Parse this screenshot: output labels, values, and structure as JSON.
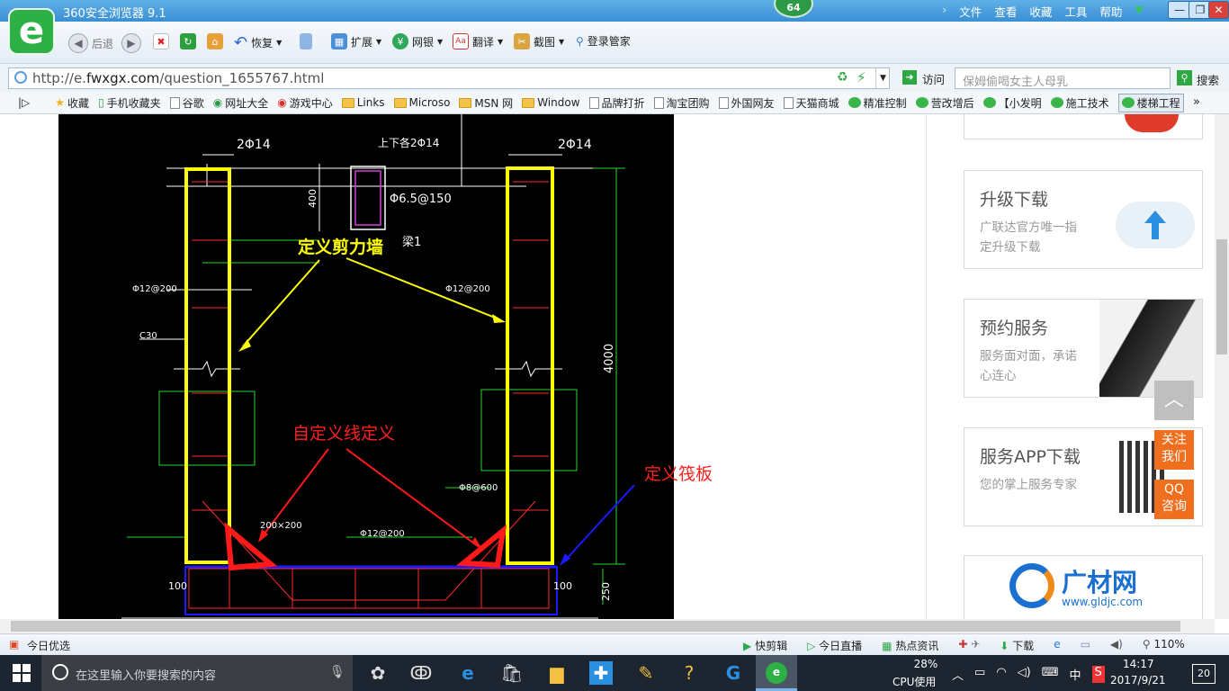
{
  "window": {
    "title": "360安全浏览器 9.1",
    "badge": "64",
    "menu": [
      "文件",
      "查看",
      "收藏",
      "工具",
      "帮助"
    ],
    "controls": {
      "minimize": "—",
      "restore": "❐",
      "close": "✕"
    }
  },
  "toolbar": {
    "back": "后退",
    "restore": "恢复",
    "extend": "扩展",
    "bank": "网银",
    "translate": "翻译",
    "screenshot": "截图",
    "login_manager": "登录管家"
  },
  "address": {
    "url_prefix": "http://e.",
    "url_host": "fwxgx.com",
    "url_path": "/question_1655767.html",
    "visit": "访问",
    "search_placeholder": "保姆偷喝女主人母乳",
    "search_button": "搜索"
  },
  "bookmarks": [
    {
      "label": "收藏",
      "icon": "star"
    },
    {
      "label": "手机收藏夹",
      "icon": "phone"
    },
    {
      "label": "谷歌",
      "icon": "page"
    },
    {
      "label": "网址大全",
      "icon": "globe"
    },
    {
      "label": "游戏中心",
      "icon": "game"
    },
    {
      "label": "Links",
      "icon": "folder"
    },
    {
      "label": "Microso",
      "icon": "folder"
    },
    {
      "label": "MSN 网",
      "icon": "folder"
    },
    {
      "label": "Window",
      "icon": "folder"
    },
    {
      "label": "品牌打折",
      "icon": "page"
    },
    {
      "label": "淘宝团购",
      "icon": "page"
    },
    {
      "label": "外国网友",
      "icon": "page"
    },
    {
      "label": "天猫商城",
      "icon": "page"
    },
    {
      "label": "精准控制",
      "icon": "wechat"
    },
    {
      "label": "营改增后",
      "icon": "wechat"
    },
    {
      "label": "【小发明",
      "icon": "wechat"
    },
    {
      "label": "施工技术",
      "icon": "wechat"
    },
    {
      "label": "楼梯工程",
      "icon": "wechat"
    }
  ],
  "cad": {
    "labels": {
      "shear_wall": "定义剪力墙",
      "custom_line": "自定义线定义",
      "raft": "定义筏板"
    },
    "dims": {
      "top_left": "2Φ14",
      "top_mid": "上下各2Φ14",
      "top_right": "2Φ14",
      "stirrup": "Φ6.5@150",
      "beam": "梁1",
      "h400": "400",
      "h4000": "4000",
      "rebar_l": "Φ12@200",
      "rebar_r": "Φ12@200",
      "c30": "C30",
      "w200": "200×200",
      "bottom": "Φ12@200",
      "b600": "Φ8@600",
      "d100l": "100",
      "d100r": "100",
      "d250": "250"
    }
  },
  "sidebar": {
    "cards": [
      {
        "title": "升级下载",
        "desc": "广联达官方唯一指定升级下载"
      },
      {
        "title": "预约服务",
        "desc": "服务面对面，承诺心连心"
      },
      {
        "title": "服务APP下载",
        "desc": "您的掌上服务专家"
      }
    ],
    "brand": {
      "name": "广材网",
      "url": "www.gldjc.com"
    },
    "follow": "关注我们",
    "qq": "QQ咨询",
    "top_label": "︿"
  },
  "statusbar": {
    "left": "今日优选",
    "items": [
      "快剪辑",
      "今日直播",
      "热点资讯",
      "下载"
    ],
    "zoom": "110%"
  },
  "taskbar": {
    "search_placeholder": "在这里输入你要搜索的内容",
    "cpu_percent": "28%",
    "cpu_label": "CPU使用",
    "ime": "中",
    "time": "14:17",
    "date": "2017/9/21",
    "notifications": "20"
  },
  "colors": {
    "titlebar": "#3a8fd4",
    "cad_bg": "#000000",
    "annot_yellow": "#ffff00",
    "annot_red": "#ff2020",
    "annot_blue": "#1a1aff"
  }
}
